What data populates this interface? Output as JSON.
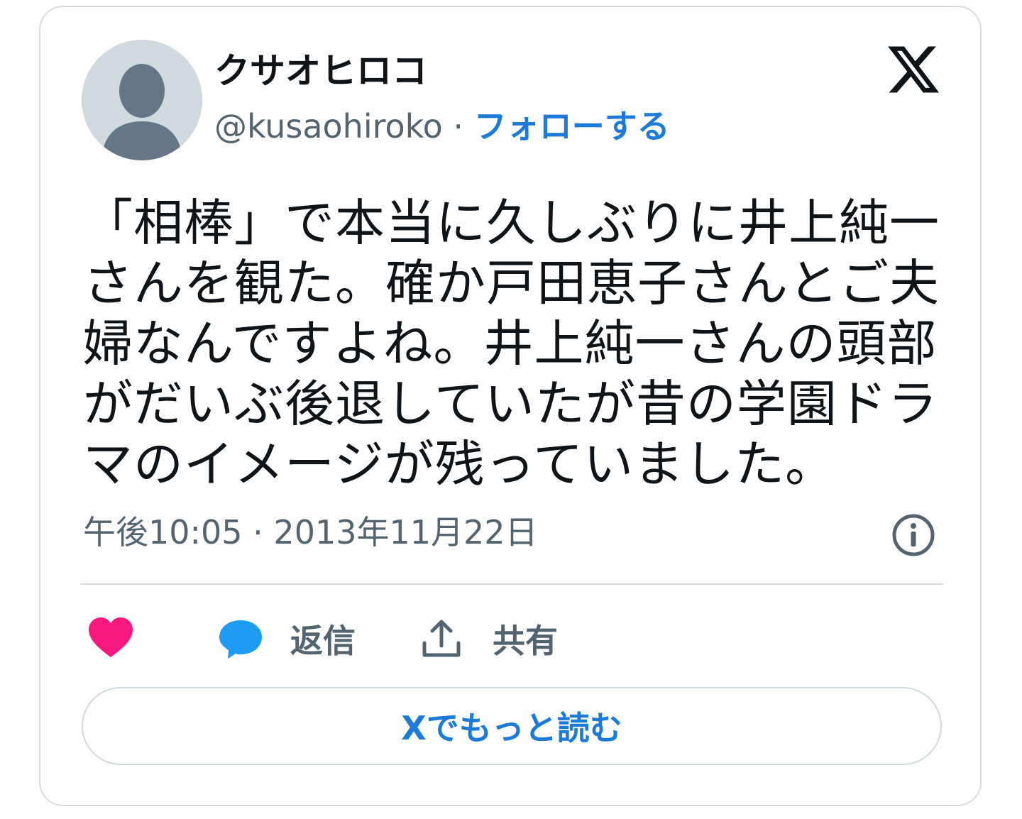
{
  "author": {
    "display_name": "クサオヒロコ",
    "handle": "@kusaohiroko",
    "separator": " · ",
    "follow_label": "フォローする"
  },
  "tweet": {
    "text": "「相棒」で本当に久しぶりに井上純一さんを観た。確か戸田恵子さんとご夫婦なんですよね。井上純一さんの頭部がだいぶ後退していたが昔の学園ドラマのイメージが残っていました。",
    "timestamp": "午後10:05 · 2013年11月22日"
  },
  "actions": {
    "reply_label": "返信",
    "share_label": "共有",
    "read_more_label": "Xでもっと読む"
  },
  "icons": {
    "avatar": "default-avatar-icon",
    "logo": "x-logo-icon",
    "info": "info-icon",
    "like": "heart-icon",
    "reply": "speech-bubble-icon",
    "share": "share-upload-icon"
  },
  "colors": {
    "accent": "#1d7bd8",
    "like": "#f91880",
    "reply": "#1d9bf0",
    "secondary_text": "#536471",
    "border": "#d6dbdf"
  }
}
